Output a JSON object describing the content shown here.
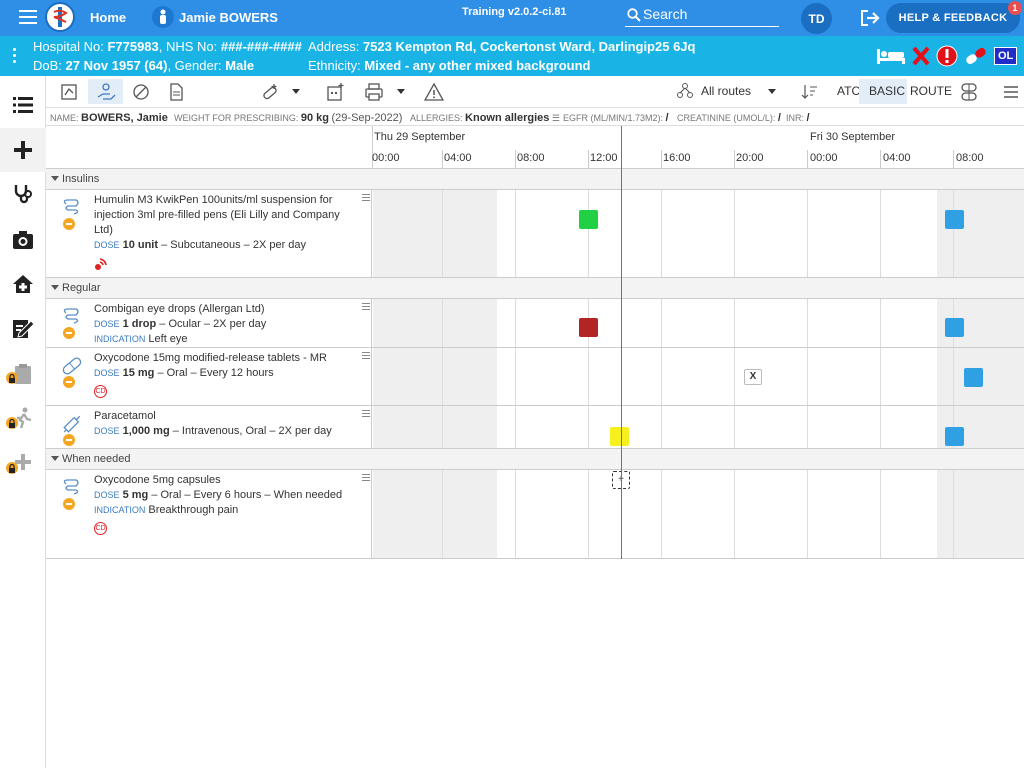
{
  "topbar": {
    "home": "Home",
    "patient_name": "Jamie BOWERS",
    "training": "Training v2.0.2-ci.81",
    "search": "Search",
    "avatar": "TD",
    "help": "HELP & FEEDBACK",
    "help_badge": "1"
  },
  "banner": {
    "hospital_label": "Hospital No:",
    "hospital_no": "F775983",
    "nhs_label": ", NHS No:",
    "nhs_no": "###-###-####",
    "dob_label": "DoB:",
    "dob": "27 Nov 1957 (64)",
    "gender_label": ", Gender:",
    "gender": "Male",
    "address_label": "Address:",
    "address": "7523 Kempton Rd, Cockertonst Ward, Darlingip25 6Jq",
    "ethnicity_label": "Ethnicity:",
    "ethnicity": "Mixed - any other mixed background",
    "ol": "OL"
  },
  "toolbar": {
    "routes": "All routes",
    "atc": "ATC",
    "basic": "BASIC",
    "route": "ROUTE"
  },
  "patinfo": {
    "name_label": "NAME:",
    "name": "BOWERS, Jamie",
    "weight_label": "WEIGHT FOR PRESCRIBING:",
    "weight": "90 kg",
    "weight_date": "(29-Sep-2022)",
    "allergies_label": "ALLERGIES:",
    "allergies": "Known allergies",
    "egfr_label": "EGFR (ML/MIN/1.73M2):",
    "egfr": "/",
    "creat_label": "CREATININE (UMOL/L):",
    "creat": "/",
    "inr_label": "INR:",
    "inr": "/"
  },
  "timeline": {
    "day1": "Thu 29 September",
    "day2": "Fri 30 September",
    "hours": [
      "00:00",
      "04:00",
      "08:00",
      "12:00",
      "16:00",
      "20:00",
      "00:00",
      "04:00",
      "08:00"
    ]
  },
  "sections": {
    "insulins": "Insulins",
    "regular": "Regular",
    "when_needed": "When needed"
  },
  "meds": {
    "humulin": {
      "name": "Humulin M3 KwikPen 100units/ml suspension for injection 3ml pre-filled pens (Eli Lilly and Company Ltd)",
      "dose_label": "DOSE",
      "dose": "10 unit",
      "detail": "– Subcutaneous – 2X per day"
    },
    "combigan": {
      "name": "Combigan eye drops (Allergan Ltd)",
      "dose_label": "DOSE",
      "dose": "1 drop",
      "detail": "– Ocular – 2X per day",
      "ind_label": "INDICATION",
      "indication": "Left eye"
    },
    "oxy15": {
      "name": "Oxycodone 15mg modified-release tablets - MR",
      "dose_label": "DOSE",
      "dose": "15 mg",
      "detail": "– Oral – Every 12 hours",
      "cd": "CD"
    },
    "paracetamol": {
      "name": "Paracetamol",
      "dose_label": "DOSE",
      "dose": "1,000 mg",
      "detail": "– Intravenous, Oral – 2X per day"
    },
    "oxy5": {
      "name": "Oxycodone 5mg capsules",
      "dose_label": "DOSE",
      "dose": "5 mg",
      "detail": "– Oral – Every 6 hours – When needed",
      "ind_label": "INDICATION",
      "indication": "Breakthrough pain",
      "cd": "CD"
    }
  },
  "grid_marks": {
    "x_label": "X",
    "plus_label": "+"
  },
  "colors": {
    "given": "#22d143",
    "missed": "#b32424",
    "due": "#f7f01f",
    "planned": "#2fa0e4",
    "now": "#e8413c"
  }
}
